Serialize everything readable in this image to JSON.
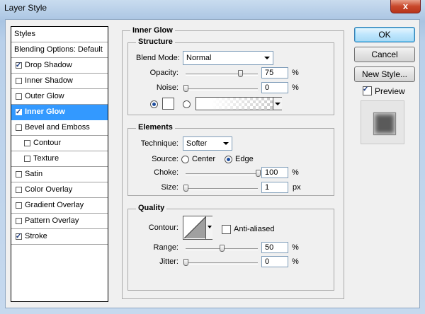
{
  "window": {
    "title": "Layer Style",
    "close": "x"
  },
  "sidebar": {
    "items": [
      {
        "label": "Styles",
        "checkbox": false,
        "checked": false,
        "indent": 0,
        "selected": false
      },
      {
        "label": "Blending Options: Default",
        "checkbox": false,
        "checked": false,
        "indent": 0,
        "selected": false
      },
      {
        "label": "Drop Shadow",
        "checkbox": true,
        "checked": true,
        "indent": 0,
        "selected": false
      },
      {
        "label": "Inner Shadow",
        "checkbox": true,
        "checked": false,
        "indent": 0,
        "selected": false
      },
      {
        "label": "Outer Glow",
        "checkbox": true,
        "checked": false,
        "indent": 0,
        "selected": false
      },
      {
        "label": "Inner Glow",
        "checkbox": true,
        "checked": true,
        "indent": 0,
        "selected": true
      },
      {
        "label": "Bevel and Emboss",
        "checkbox": true,
        "checked": false,
        "indent": 0,
        "selected": false
      },
      {
        "label": "Contour",
        "checkbox": true,
        "checked": false,
        "indent": 1,
        "selected": false
      },
      {
        "label": "Texture",
        "checkbox": true,
        "checked": false,
        "indent": 1,
        "selected": false
      },
      {
        "label": "Satin",
        "checkbox": true,
        "checked": false,
        "indent": 0,
        "selected": false
      },
      {
        "label": "Color Overlay",
        "checkbox": true,
        "checked": false,
        "indent": 0,
        "selected": false
      },
      {
        "label": "Gradient Overlay",
        "checkbox": true,
        "checked": false,
        "indent": 0,
        "selected": false
      },
      {
        "label": "Pattern Overlay",
        "checkbox": true,
        "checked": false,
        "indent": 0,
        "selected": false
      },
      {
        "label": "Stroke",
        "checkbox": true,
        "checked": true,
        "indent": 0,
        "selected": false
      }
    ]
  },
  "panel": {
    "title": "Inner Glow",
    "structure": {
      "title": "Structure",
      "blend_mode_label": "Blend Mode:",
      "blend_mode_value": "Normal",
      "opacity_label": "Opacity:",
      "opacity_value": "75",
      "opacity_level": 0.75,
      "opacity_unit": "%",
      "noise_label": "Noise:",
      "noise_value": "0",
      "noise_level": 0,
      "noise_unit": "%",
      "color_swatch": "#ffffff"
    },
    "elements": {
      "title": "Elements",
      "technique_label": "Technique:",
      "technique_value": "Softer",
      "source_label": "Source:",
      "source_center": "Center",
      "source_edge": "Edge",
      "choke_label": "Choke:",
      "choke_value": "100",
      "choke_level": 1.0,
      "choke_unit": "%",
      "size_label": "Size:",
      "size_value": "1",
      "size_level": 0.004,
      "size_unit": "px"
    },
    "quality": {
      "title": "Quality",
      "contour_label": "Contour:",
      "antialiased_label": "Anti-aliased",
      "range_label": "Range:",
      "range_value": "50",
      "range_level": 0.5,
      "range_unit": "%",
      "jitter_label": "Jitter:",
      "jitter_value": "0",
      "jitter_level": 0,
      "jitter_unit": "%"
    }
  },
  "buttons": {
    "ok": "OK",
    "cancel": "Cancel",
    "new_style": "New Style..."
  },
  "preview": {
    "label": "Preview",
    "checked": true
  }
}
